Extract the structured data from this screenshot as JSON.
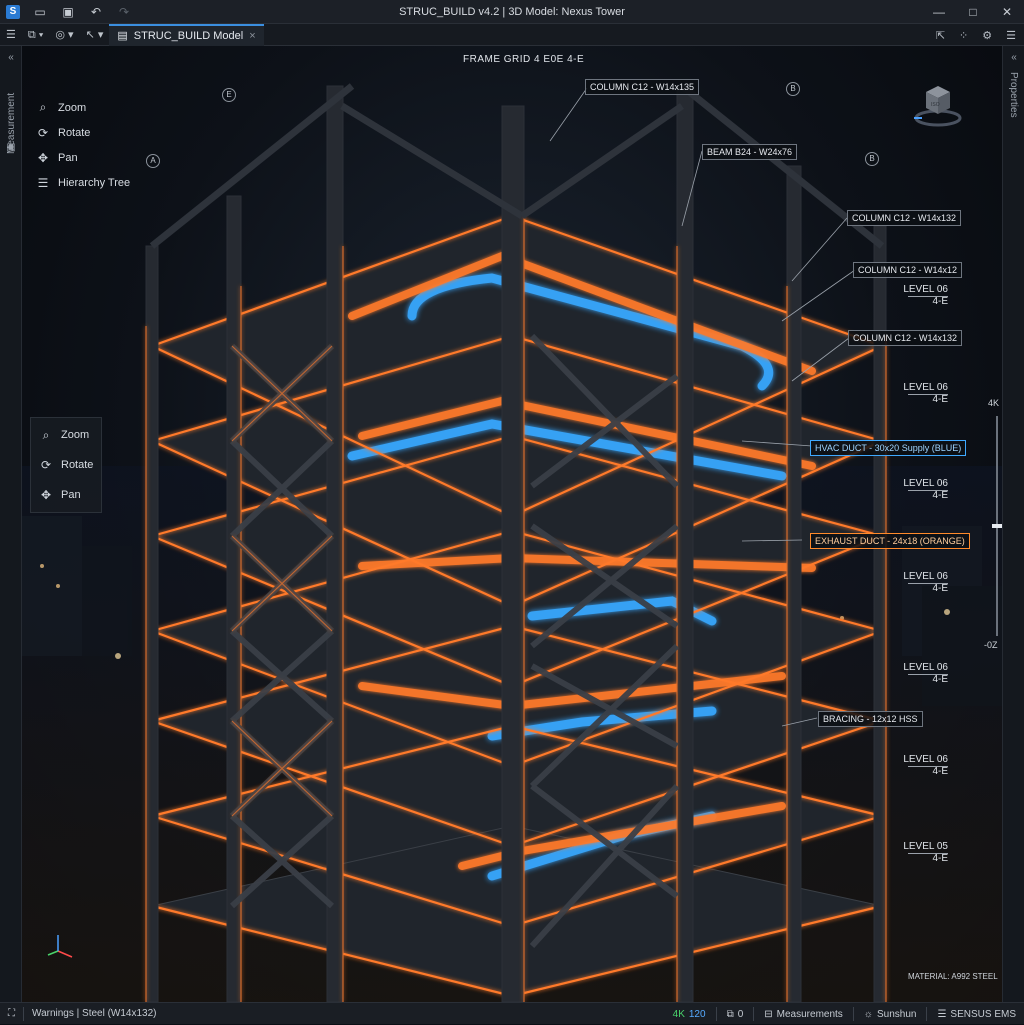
{
  "window": {
    "title": "STRUC_BUILD v4.2 | 3D Model: Nexus Tower",
    "controls": [
      "—",
      "□",
      "✕"
    ]
  },
  "toolbar": {
    "tab_label": "STRUC_BUILD Model",
    "tab_close": "×"
  },
  "left_rail": {
    "label": "Measurement"
  },
  "right_rail": {
    "label": "Properties"
  },
  "tool_menu_top": [
    {
      "icon": "zoom-icon",
      "label": "Zoom"
    },
    {
      "icon": "rotate-icon",
      "label": "Rotate"
    },
    {
      "icon": "pan-icon",
      "label": "Pan"
    },
    {
      "icon": "hierarchy-icon",
      "label": "Hierarchy Tree"
    }
  ],
  "tool_menu_panel": [
    {
      "icon": "zoom-icon",
      "label": "Zoom"
    },
    {
      "icon": "rotate-icon",
      "label": "Rotate"
    },
    {
      "icon": "pan-icon",
      "label": "Pan"
    }
  ],
  "viewport": {
    "frame_label": "FRAME GRID 4 E0E 4-E",
    "grid_bubbles": [
      "E",
      "A",
      "B",
      "B"
    ],
    "callouts": [
      {
        "text": "COLUMN C12 - W14x135",
        "kind": "plain"
      },
      {
        "text": "BEAM B24 - W24x76",
        "kind": "plain"
      },
      {
        "text": "COLUMN C12 - W14x132",
        "kind": "plain"
      },
      {
        "text": "COLUMN C12 - W14x12",
        "kind": "plain"
      },
      {
        "text": "COLUMN C12 - W14x132",
        "kind": "plain"
      },
      {
        "text": "HVAC DUCT - 30x20 Supply (BLUE)",
        "kind": "blue"
      },
      {
        "text": "EXHAUST DUCT - 24x18 (ORANGE)",
        "kind": "orange"
      },
      {
        "text": "BRACING - 12x12 HSS",
        "kind": "plain"
      }
    ],
    "levels": [
      {
        "name": "LEVEL 06",
        "grid": "4-E"
      },
      {
        "name": "LEVEL 06",
        "grid": "4-E"
      },
      {
        "name": "LEVEL 06",
        "grid": "4-E"
      },
      {
        "name": "LEVEL 06",
        "grid": "4-E"
      },
      {
        "name": "LEVEL 06",
        "grid": "4-E"
      },
      {
        "name": "LEVEL 06",
        "grid": "4-E"
      },
      {
        "name": "LEVEL 05",
        "grid": "4-E"
      }
    ],
    "zoom_slider": {
      "top": "4K",
      "bottom": "-0Z",
      "level": 0.5
    },
    "material": "MATERIAL: A992 STEEL",
    "colors": {
      "steel_orange": "#ff7a2a",
      "duct_blue": "#39a8ff",
      "steel_dark": "#2b2f36"
    }
  },
  "statusbar": {
    "selection": "Warnings | Steel (W14x132)",
    "res": "4K",
    "fps": "120",
    "counter": "0",
    "measure": "Measurements",
    "sun": "Sunshun",
    "sensors": "SENSUS EMS"
  }
}
